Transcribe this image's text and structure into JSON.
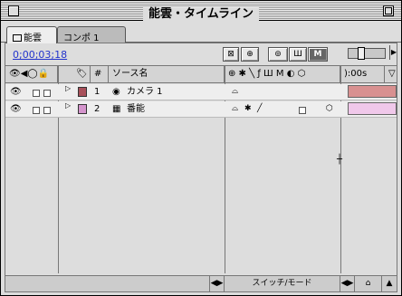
{
  "window": {
    "title": "能雲・タイムライン"
  },
  "tabs": [
    {
      "label": "能雲"
    },
    {
      "label": "コンポ 1"
    }
  ],
  "timecode": "0;00;03;18",
  "time_ruler_label": "):00s",
  "toolbar": {
    "btn1": "⊠",
    "btn2": "⊕",
    "btn3": "⊚",
    "btn4": "Ш",
    "btn5": "M"
  },
  "columns": {
    "av_switches": "👁◀◯🔒",
    "label": "🏷",
    "number": "#",
    "source_name": "ソース名",
    "switches": "⊕ ✱ ╲ ƒ Ш M ◐ ⬡"
  },
  "layers": [
    {
      "number": "1",
      "name": "カメラ 1",
      "color": "#a8505a",
      "type_icon": "camera-icon",
      "bar_color": "#d89090"
    },
    {
      "number": "2",
      "name": "番能",
      "color": "#d494cc",
      "type_icon": "footage-icon",
      "bar_color": "#f0c8ea"
    }
  ],
  "bottom_bar": {
    "mode_toggle": "スイッチ/モード"
  }
}
